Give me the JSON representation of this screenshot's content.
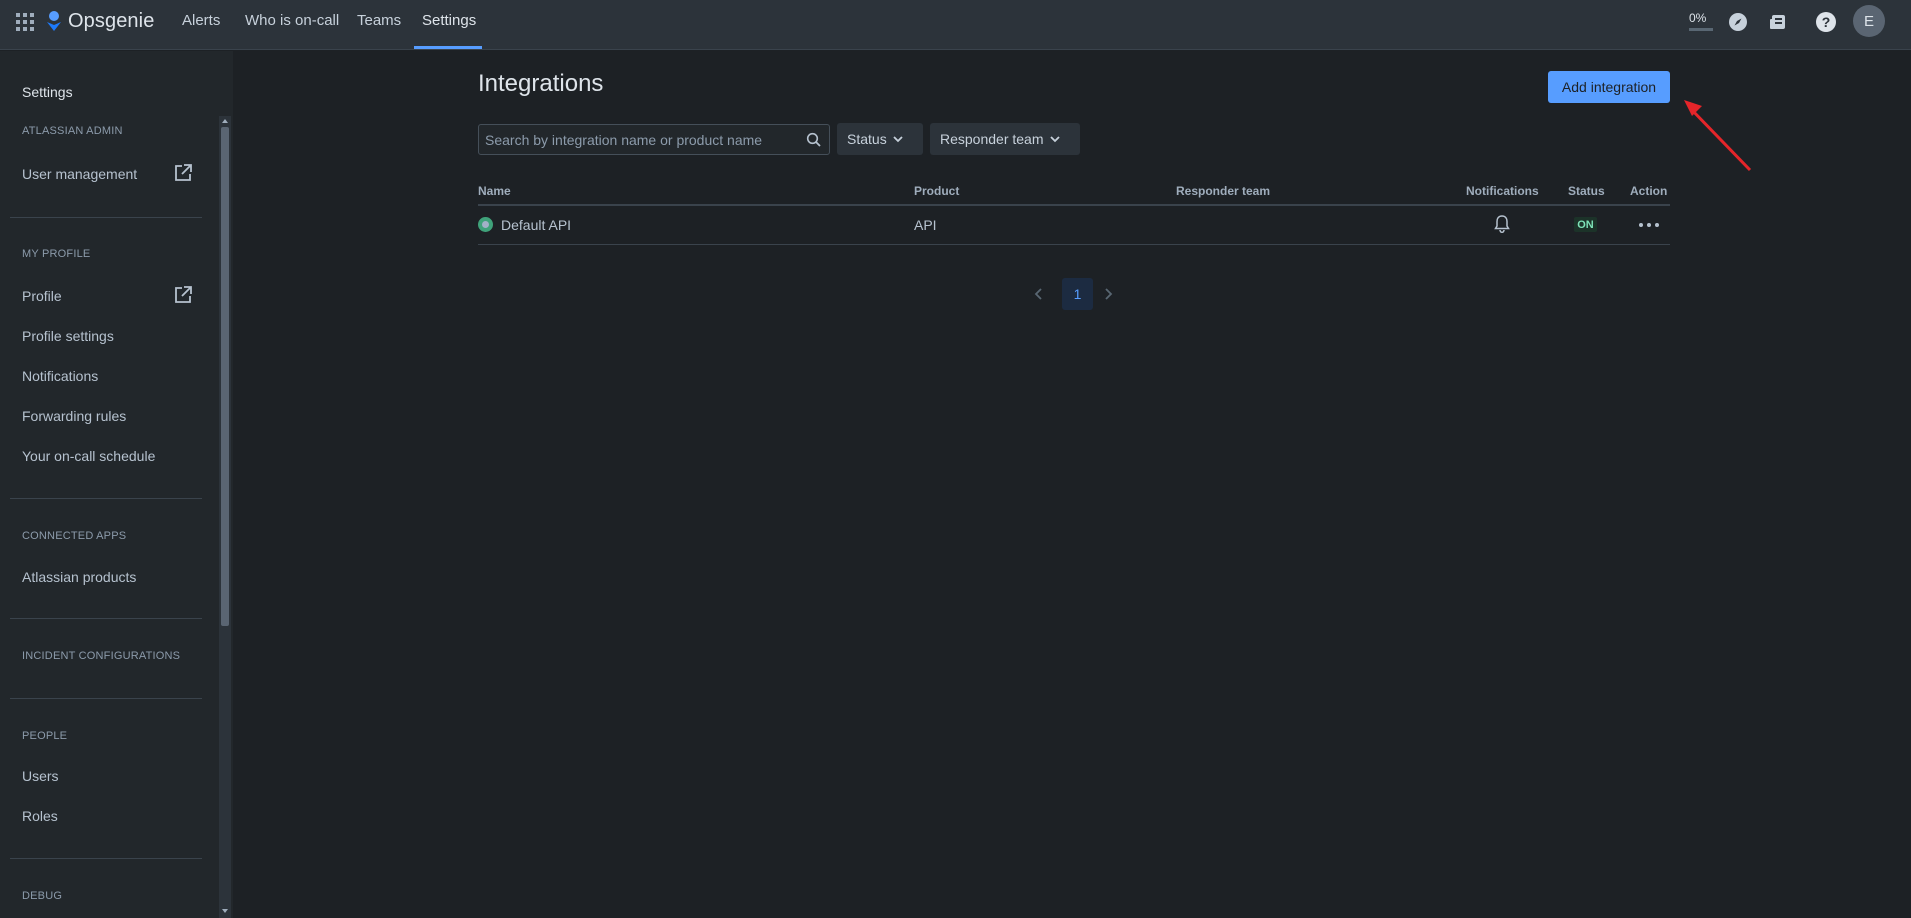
{
  "app": {
    "name": "Opsgenie"
  },
  "nav": {
    "items": [
      {
        "label": "Alerts"
      },
      {
        "label": "Who is on-call"
      },
      {
        "label": "Teams"
      },
      {
        "label": "Settings",
        "active": true
      }
    ],
    "progress_label": "0%",
    "avatar_initial": "E",
    "icons": [
      "app-switcher-icon",
      "compass-icon",
      "news-icon",
      "help-icon"
    ]
  },
  "sidebar": {
    "title": "Settings",
    "sections": [
      {
        "label": "ATLASSIAN ADMIN",
        "items": [
          {
            "label": "User management",
            "external": true
          }
        ]
      },
      {
        "label": "MY PROFILE",
        "items": [
          {
            "label": "Profile",
            "external": true
          },
          {
            "label": "Profile settings"
          },
          {
            "label": "Notifications"
          },
          {
            "label": "Forwarding rules"
          },
          {
            "label": "Your on-call schedule"
          }
        ]
      },
      {
        "label": "CONNECTED APPS",
        "items": [
          {
            "label": "Atlassian products"
          }
        ]
      },
      {
        "label": "INCIDENT CONFIGURATIONS",
        "items": []
      },
      {
        "label": "PEOPLE",
        "items": [
          {
            "label": "Users"
          },
          {
            "label": "Roles"
          }
        ]
      },
      {
        "label": "DEBUG",
        "items": []
      }
    ]
  },
  "main": {
    "title": "Integrations",
    "add_button": "Add integration",
    "search": {
      "placeholder": "Search by integration name or product name",
      "value": ""
    },
    "filters": [
      {
        "label": "Status"
      },
      {
        "label": "Responder team"
      }
    ],
    "table": {
      "columns": [
        "Name",
        "Product",
        "Responder team",
        "Notifications",
        "Status",
        "Action"
      ],
      "rows": [
        {
          "name": "Default API",
          "product": "API",
          "responder_team": "",
          "notifications": "bell-icon",
          "status": "ON",
          "action": "more-icon"
        }
      ]
    },
    "pagination": {
      "current": "1"
    }
  },
  "colors": {
    "accent": "#579dff",
    "background": "#1d2125",
    "sidebar": "#22272b",
    "topbar": "#2c333a",
    "status_on": "#7ee2b8",
    "annotation_arrow": "#e5252a"
  }
}
